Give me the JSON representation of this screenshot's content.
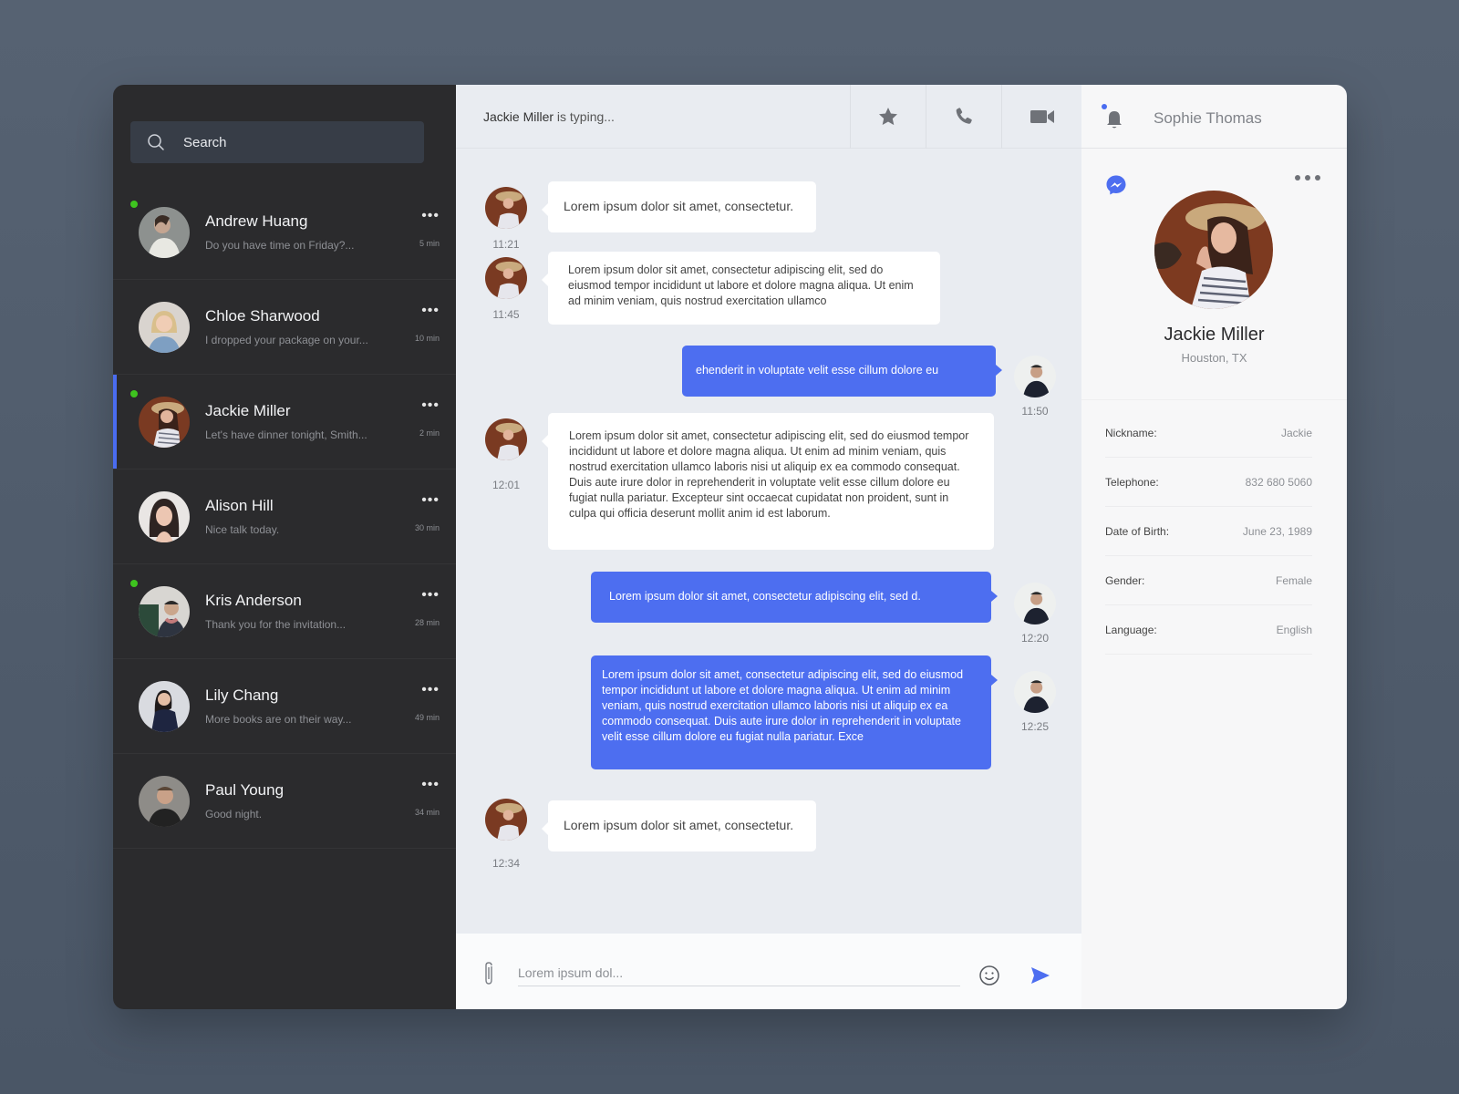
{
  "sidebar": {
    "search_placeholder": "Search",
    "contacts": [
      {
        "name": "Andrew Huang",
        "preview": "Do you have time on Friday?...",
        "time": "5 min",
        "online": true,
        "active": false
      },
      {
        "name": "Chloe Sharwood",
        "preview": "I dropped your package on your...",
        "time": "10 min",
        "online": false,
        "active": false
      },
      {
        "name": "Jackie Miller",
        "preview": "Let's have dinner tonight, Smith...",
        "time": "2 min",
        "online": true,
        "active": true
      },
      {
        "name": "Alison Hill",
        "preview": "Nice talk today.",
        "time": "30 min",
        "online": false,
        "active": false
      },
      {
        "name": "Kris Anderson",
        "preview": "Thank you for the invitation...",
        "time": "28 min",
        "online": true,
        "active": false
      },
      {
        "name": "Lily Chang",
        "preview": "More books are on their way...",
        "time": "49 min",
        "online": false,
        "active": false
      },
      {
        "name": "Paul Young",
        "preview": "Good night.",
        "time": "34 min",
        "online": false,
        "active": false
      }
    ],
    "more_label": "•••"
  },
  "chat": {
    "typing_name": "Jackie Miller",
    "typing_suffix": " is typing...",
    "messages": [
      {
        "direction": "in",
        "time": "11:21",
        "text": "Lorem ipsum dolor sit amet, consectetur."
      },
      {
        "direction": "in",
        "time": "11:45",
        "text": "Lorem ipsum dolor sit amet, consectetur adipiscing elit, sed do eiusmod tempor incididunt ut labore et dolore magna aliqua. Ut enim ad minim veniam, quis nostrud exercitation ullamco"
      },
      {
        "direction": "out",
        "time": "11:50",
        "text": "ehenderit in voluptate velit esse cillum dolore eu"
      },
      {
        "direction": "in",
        "time": "12:01",
        "text": "Lorem ipsum dolor sit amet, consectetur adipiscing elit, sed do eiusmod tempor incididunt ut labore et dolore magna aliqua. Ut enim ad minim veniam, quis nostrud exercitation ullamco laboris nisi ut aliquip ex ea commodo consequat. Duis aute irure dolor in reprehenderit in voluptate velit esse cillum dolore eu fugiat nulla pariatur. Excepteur sint occaecat cupidatat non proident, sunt in culpa qui officia deserunt mollit anim id est laborum."
      },
      {
        "direction": "out",
        "time": "12:20",
        "text": "Lorem ipsum dolor sit amet, consectetur adipiscing elit, sed d."
      },
      {
        "direction": "out",
        "time": "12:25",
        "text": "Lorem ipsum dolor sit amet, consectetur adipiscing elit, sed do eiusmod tempor incididunt ut labore et dolore magna aliqua. Ut enim ad minim veniam, quis nostrud exercitation ullamco laboris nisi ut aliquip ex ea commodo consequat. Duis aute irure dolor in reprehenderit in voluptate velit esse cillum dolore eu fugiat nulla pariatur. Exce"
      },
      {
        "direction": "in",
        "time": "12:34",
        "text": "Lorem ipsum dolor sit amet, consectetur."
      }
    ],
    "composer_placeholder": "Lorem ipsum dol..."
  },
  "profile": {
    "current_user": "Sophie Thomas",
    "name": "Jackie Miller",
    "location": "Houston, TX",
    "details": [
      {
        "label": "Nickname:",
        "value": "Jackie"
      },
      {
        "label": "Telephone:",
        "value": "832 680 5060"
      },
      {
        "label": "Date of Birth:",
        "value": "June 23, 1989"
      },
      {
        "label": "Gender:",
        "value": "Female"
      },
      {
        "label": "Language:",
        "value": "English"
      }
    ]
  },
  "colors": {
    "accent": "#4d6ef0",
    "online": "#3ec41f",
    "sidebar_bg": "#2b2b2d",
    "chat_bg": "#e9ecf1"
  }
}
